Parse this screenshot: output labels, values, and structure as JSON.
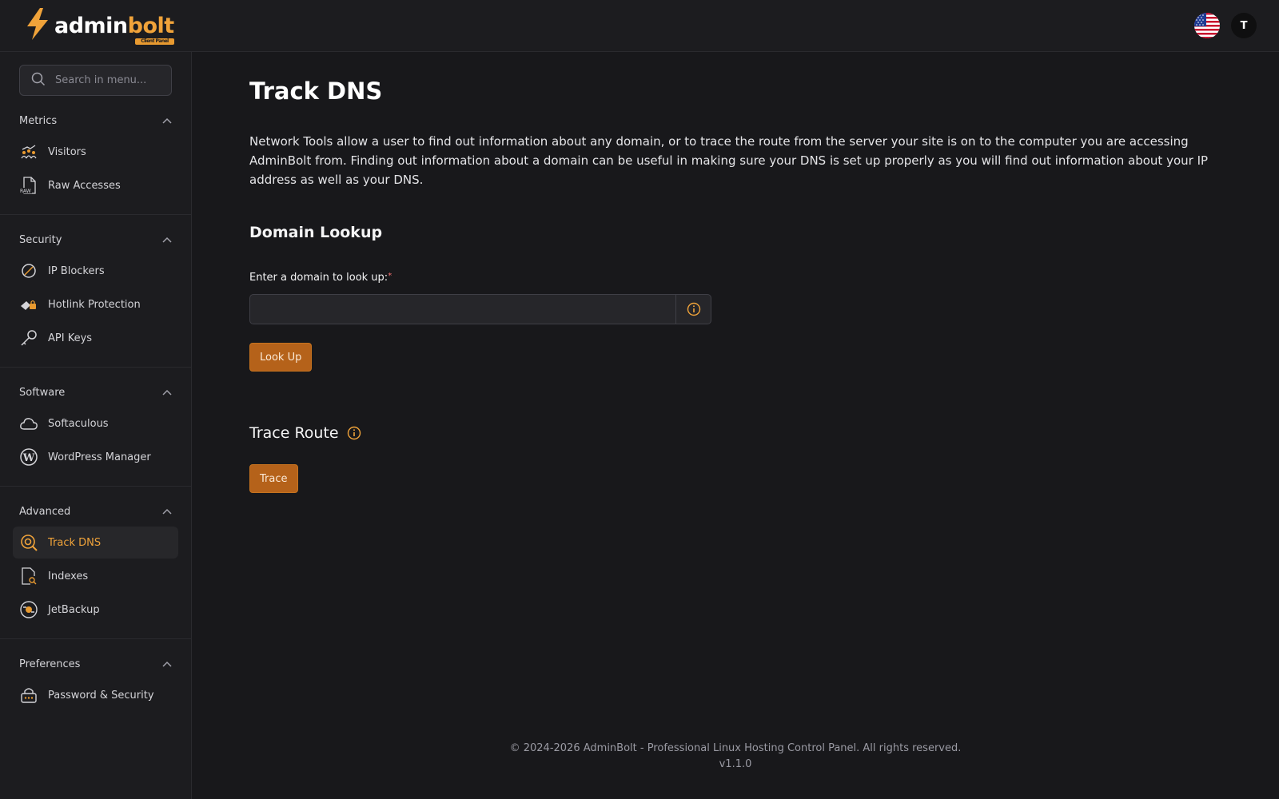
{
  "brand": {
    "name_part1": "admin",
    "name_part2": "bolt",
    "badge": "Client Panel",
    "accent": "#f0a33a"
  },
  "header": {
    "avatar_initial": "T",
    "flag": "us-flag-icon"
  },
  "sidebar": {
    "search_placeholder": "Search in menu...",
    "sections": [
      {
        "title": "Metrics",
        "items": [
          {
            "label": "Visitors",
            "icon": "visitors-icon"
          },
          {
            "label": "Raw Accesses",
            "icon": "raw-file-icon"
          }
        ]
      },
      {
        "title": "Security",
        "items": [
          {
            "label": "IP Blockers",
            "icon": "block-icon"
          },
          {
            "label": "Hotlink Protection",
            "icon": "hotlink-icon"
          },
          {
            "label": "API Keys",
            "icon": "key-icon"
          }
        ]
      },
      {
        "title": "Software",
        "items": [
          {
            "label": "Softaculous",
            "icon": "cloud-icon"
          },
          {
            "label": "WordPress Manager",
            "icon": "wordpress-icon"
          }
        ]
      },
      {
        "title": "Advanced",
        "items": [
          {
            "label": "Track DNS",
            "icon": "dns-search-icon",
            "active": true
          },
          {
            "label": "Indexes",
            "icon": "file-search-icon"
          },
          {
            "label": "JetBackup",
            "icon": "backup-icon"
          }
        ]
      },
      {
        "title": "Preferences",
        "items": [
          {
            "label": "Password & Security",
            "icon": "password-icon"
          }
        ]
      }
    ]
  },
  "main": {
    "title": "Track DNS",
    "description": "Network Tools allow a user to find out information about any domain, or to trace the route from the server your site is on to the computer you are accessing AdminBolt from. Finding out information about a domain can be useful in making sure your DNS is set up properly as you will find out information about your IP address as well as your DNS.",
    "domain_lookup": {
      "heading": "Domain Lookup",
      "label": "Enter a domain to look up:",
      "required_mark": "*",
      "value": "",
      "button": "Look Up"
    },
    "trace_route": {
      "heading": "Trace Route",
      "button": "Trace"
    }
  },
  "footer": {
    "copyright": "© 2024-2026 AdminBolt - Professional Linux Hosting Control Panel. All rights reserved.",
    "version": "v1.1.0"
  }
}
